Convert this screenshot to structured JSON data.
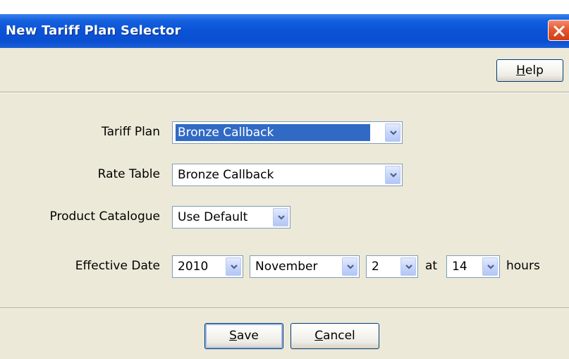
{
  "window": {
    "title": "New Tariff Plan Selector",
    "close_icon": "close-icon"
  },
  "toolbar": {
    "help_label_prefix": "",
    "help_mnemonic": "H",
    "help_label_rest": "elp"
  },
  "form": {
    "tariff_plan": {
      "label": "Tariff Plan",
      "value": "Bronze Callback"
    },
    "rate_table": {
      "label": "Rate Table",
      "value": "Bronze Callback"
    },
    "product_catalogue": {
      "label": "Product Catalogue",
      "value": "Use Default"
    },
    "effective_date": {
      "label": "Effective Date",
      "year": "2010",
      "month": "November",
      "day": "2",
      "at_text": "at",
      "hour": "14",
      "hours_text": "hours"
    }
  },
  "footer": {
    "save_mnemonic": "S",
    "save_rest": "ave",
    "cancel_mnemonic": "C",
    "cancel_rest": "ancel"
  },
  "colors": {
    "titlebar": "#0a53d6",
    "panel": "#ece9d8",
    "selection": "#316ac5",
    "close": "#d23c14"
  }
}
